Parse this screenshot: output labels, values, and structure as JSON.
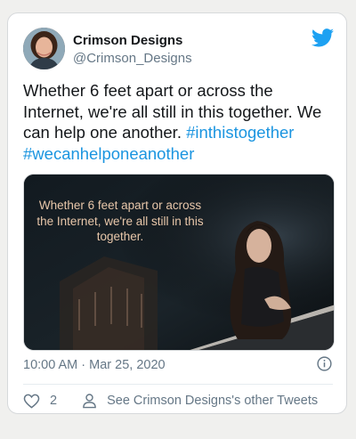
{
  "tweet": {
    "author_name": "Crimson Designs",
    "author_handle": "@Crimson_Designs",
    "text_part1": "Whether 6 feet apart or across the Internet, we're all still in this together. We can help one another. ",
    "hashtag1": "#inthistogether",
    "hashtag2": "#wecanhelponeanother",
    "media_caption": "Whether 6 feet apart or across the Internet, we're all still in this  together.",
    "timestamp": "10:00 AM · Mar 25, 2020",
    "like_count": "2",
    "other_tweets_label": "See Crimson Designs's other Tweets"
  },
  "colors": {
    "link": "#1b95e0",
    "secondary_text": "#657786",
    "caption": "#e8c7aa"
  },
  "icons": {
    "brand": "twitter-bird-icon",
    "info": "info-icon",
    "like": "heart-icon",
    "profile": "person-icon"
  }
}
